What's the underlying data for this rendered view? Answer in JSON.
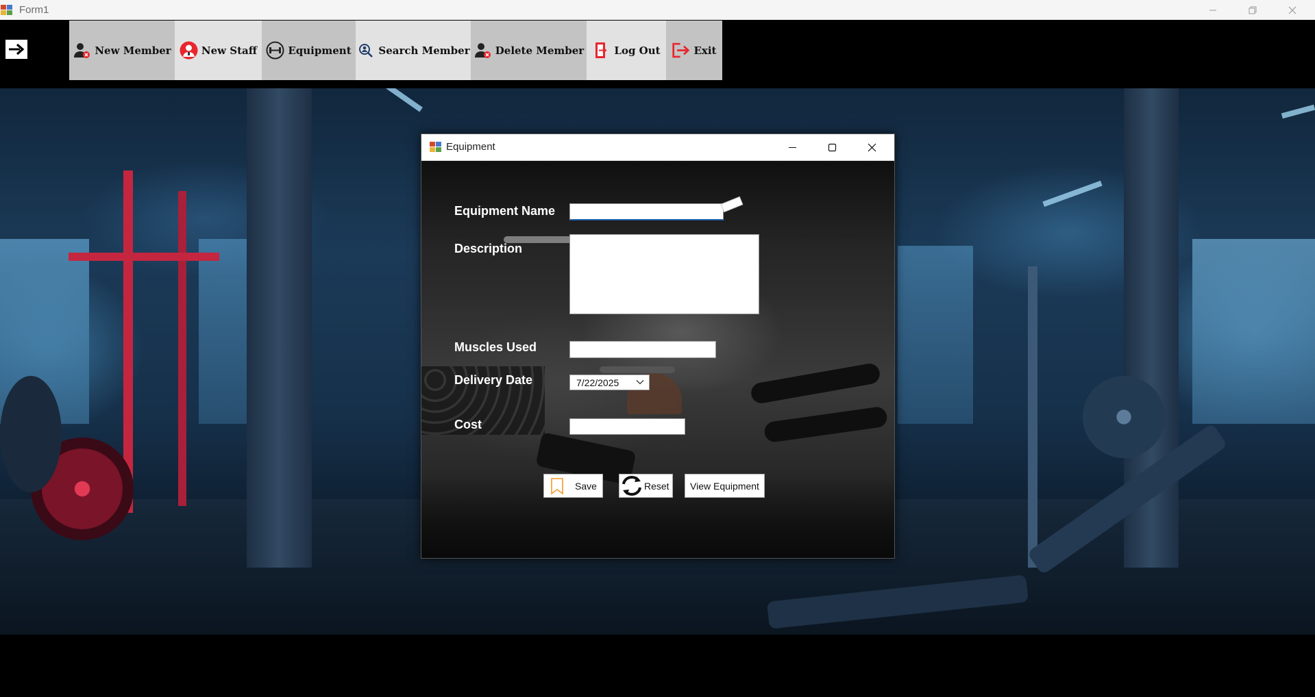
{
  "window": {
    "title": "Form1",
    "app_icon": "form-app-icon",
    "controls": {
      "minimize": "minimize-icon",
      "restore": "restore-icon",
      "close": "close-icon"
    }
  },
  "menu": {
    "toggle_icon": "arrow-right-icon",
    "items": [
      {
        "label": "New Member",
        "icon": "add-user-icon"
      },
      {
        "label": "New Staff",
        "icon": "staff-icon"
      },
      {
        "label": "Equipment",
        "icon": "dumbbell-icon"
      },
      {
        "label": "Search Member",
        "icon": "search-member-icon"
      },
      {
        "label": "Delete Member",
        "icon": "delete-user-icon"
      },
      {
        "label": "Log Out",
        "icon": "logout-icon"
      },
      {
        "label": "Exit",
        "icon": "exit-icon"
      }
    ]
  },
  "dialog": {
    "title": "Equipment",
    "icon": "form-app-icon",
    "controls": {
      "minimize": "minimize-icon",
      "maximize": "maximize-icon",
      "close": "close-icon"
    },
    "fields": {
      "equipment_name": {
        "label": "Equipment Name",
        "value": ""
      },
      "description": {
        "label": "Description",
        "value": ""
      },
      "muscles_used": {
        "label": "Muscles Used",
        "value": ""
      },
      "delivery_date": {
        "label": "Delivery Date",
        "value": "7/22/2025"
      },
      "cost": {
        "label": "Cost",
        "value": ""
      }
    },
    "buttons": {
      "save": {
        "label": "Save",
        "icon": "bookmark-icon"
      },
      "reset": {
        "label": "Reset",
        "icon": "refresh-icon"
      },
      "view": {
        "label": "View Equipment"
      }
    }
  },
  "colors": {
    "menu_dark": "#c3c3c3",
    "menu_light": "#e2e2e2",
    "icon_red": "#e8262e",
    "input_focus": "#1e5fae",
    "background_blue": "#1b3a57"
  }
}
